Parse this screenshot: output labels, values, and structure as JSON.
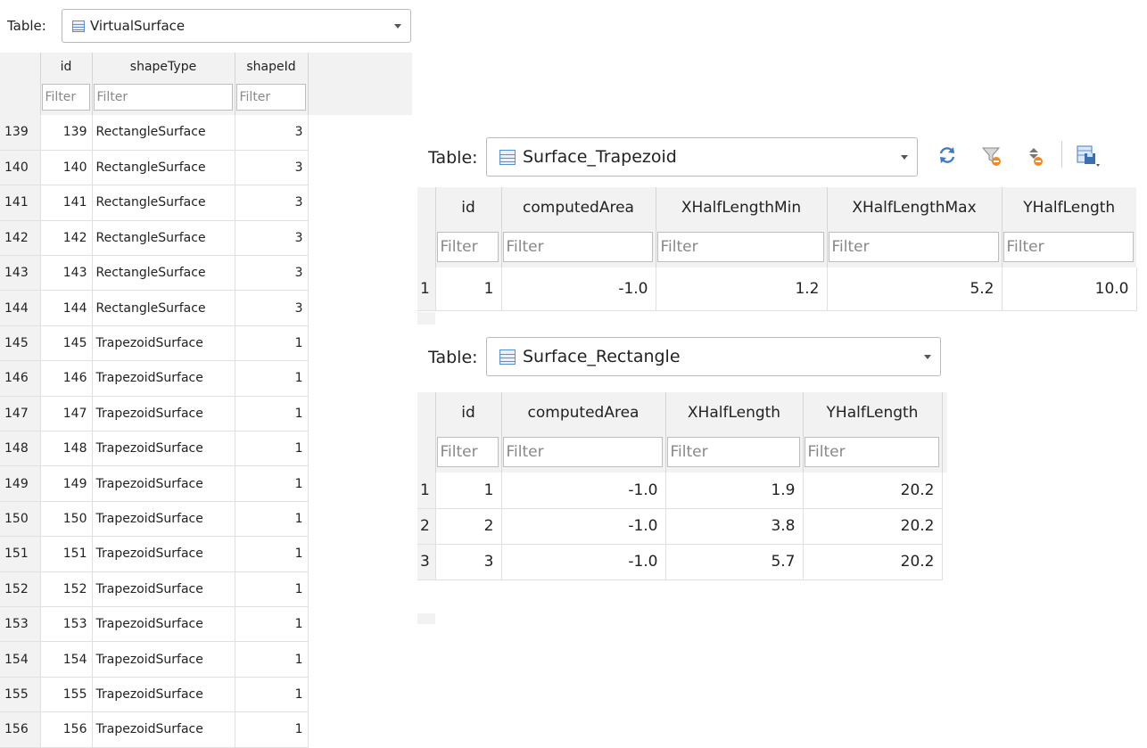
{
  "left": {
    "label": "Table:",
    "table_name": "VirtualSurface",
    "columns": [
      "id",
      "shapeType",
      "shapeId"
    ],
    "filter_placeholder": "Filter",
    "rows": [
      {
        "rownum": "139",
        "id": "139",
        "shapeType": "RectangleSurface",
        "shapeId": "3"
      },
      {
        "rownum": "140",
        "id": "140",
        "shapeType": "RectangleSurface",
        "shapeId": "3"
      },
      {
        "rownum": "141",
        "id": "141",
        "shapeType": "RectangleSurface",
        "shapeId": "3"
      },
      {
        "rownum": "142",
        "id": "142",
        "shapeType": "RectangleSurface",
        "shapeId": "3"
      },
      {
        "rownum": "143",
        "id": "143",
        "shapeType": "RectangleSurface",
        "shapeId": "3"
      },
      {
        "rownum": "144",
        "id": "144",
        "shapeType": "RectangleSurface",
        "shapeId": "3"
      },
      {
        "rownum": "145",
        "id": "145",
        "shapeType": "TrapezoidSurface",
        "shapeId": "1"
      },
      {
        "rownum": "146",
        "id": "146",
        "shapeType": "TrapezoidSurface",
        "shapeId": "1"
      },
      {
        "rownum": "147",
        "id": "147",
        "shapeType": "TrapezoidSurface",
        "shapeId": "1"
      },
      {
        "rownum": "148",
        "id": "148",
        "shapeType": "TrapezoidSurface",
        "shapeId": "1"
      },
      {
        "rownum": "149",
        "id": "149",
        "shapeType": "TrapezoidSurface",
        "shapeId": "1"
      },
      {
        "rownum": "150",
        "id": "150",
        "shapeType": "TrapezoidSurface",
        "shapeId": "1"
      },
      {
        "rownum": "151",
        "id": "151",
        "shapeType": "TrapezoidSurface",
        "shapeId": "1"
      },
      {
        "rownum": "152",
        "id": "152",
        "shapeType": "TrapezoidSurface",
        "shapeId": "1"
      },
      {
        "rownum": "153",
        "id": "153",
        "shapeType": "TrapezoidSurface",
        "shapeId": "1"
      },
      {
        "rownum": "154",
        "id": "154",
        "shapeType": "TrapezoidSurface",
        "shapeId": "1"
      },
      {
        "rownum": "155",
        "id": "155",
        "shapeType": "TrapezoidSurface",
        "shapeId": "1"
      },
      {
        "rownum": "156",
        "id": "156",
        "shapeType": "TrapezoidSurface",
        "shapeId": "1"
      }
    ]
  },
  "trapezoid": {
    "label": "Table:",
    "table_name": "Surface_Trapezoid",
    "columns": [
      "id",
      "computedArea",
      "XHalfLengthMin",
      "XHalfLengthMax",
      "YHalfLength"
    ],
    "filter_placeholder": "Filter",
    "rows": [
      {
        "rownum": "1",
        "cells": [
          "1",
          "-1.0",
          "1.2",
          "5.2",
          "10.0"
        ]
      }
    ],
    "toolbar_icons": [
      "refresh-icon",
      "clear-filters-icon",
      "sort-icon",
      "save-table-icon"
    ]
  },
  "rectangle": {
    "label": "Table:",
    "table_name": "Surface_Rectangle",
    "columns": [
      "id",
      "computedArea",
      "XHalfLength",
      "YHalfLength"
    ],
    "filter_placeholder": "Filter",
    "rows": [
      {
        "rownum": "1",
        "cells": [
          "1",
          "-1.0",
          "1.9",
          "20.2"
        ]
      },
      {
        "rownum": "2",
        "cells": [
          "2",
          "-1.0",
          "3.8",
          "20.2"
        ]
      },
      {
        "rownum": "3",
        "cells": [
          "3",
          "-1.0",
          "5.7",
          "20.2"
        ]
      }
    ]
  },
  "colors": {
    "header_bg": "#f2f2f2",
    "grid": "#e0e0e0",
    "accent": "#5a8fce"
  }
}
